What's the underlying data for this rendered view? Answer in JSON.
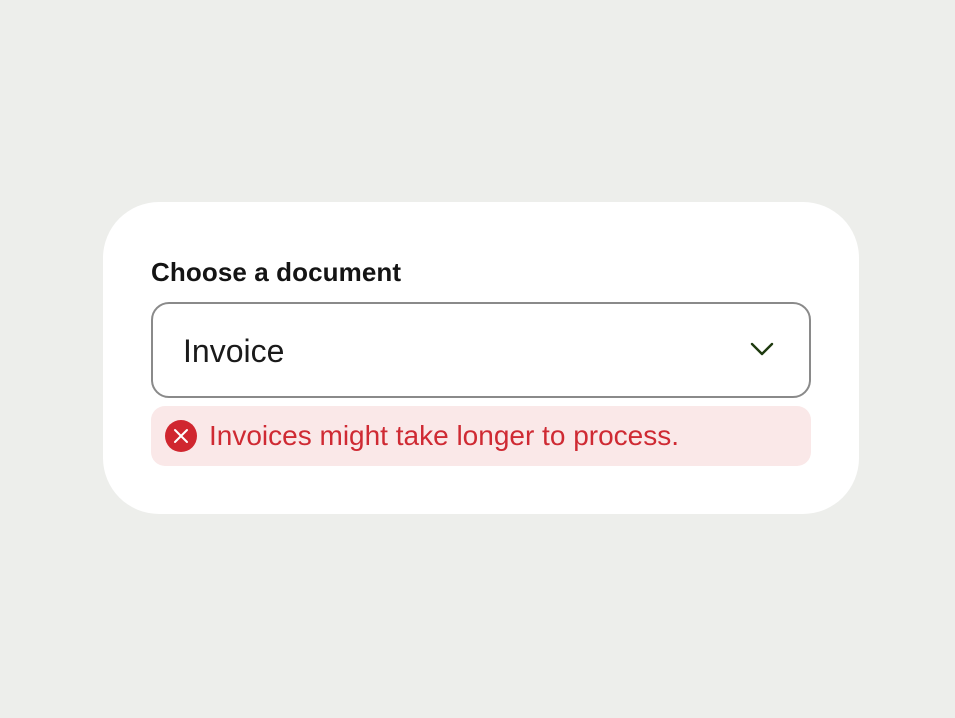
{
  "form": {
    "label": "Choose a document",
    "select": {
      "value": "Invoice",
      "icon": "chevron-down-icon"
    },
    "error": {
      "icon": "error-x-icon",
      "message": "Invoices might take longer to process."
    }
  },
  "colors": {
    "background": "#edeeeb",
    "card": "#ffffff",
    "error_text": "#cf2a33",
    "error_bg": "#fae8e8",
    "chevron": "#1e3a0f"
  }
}
